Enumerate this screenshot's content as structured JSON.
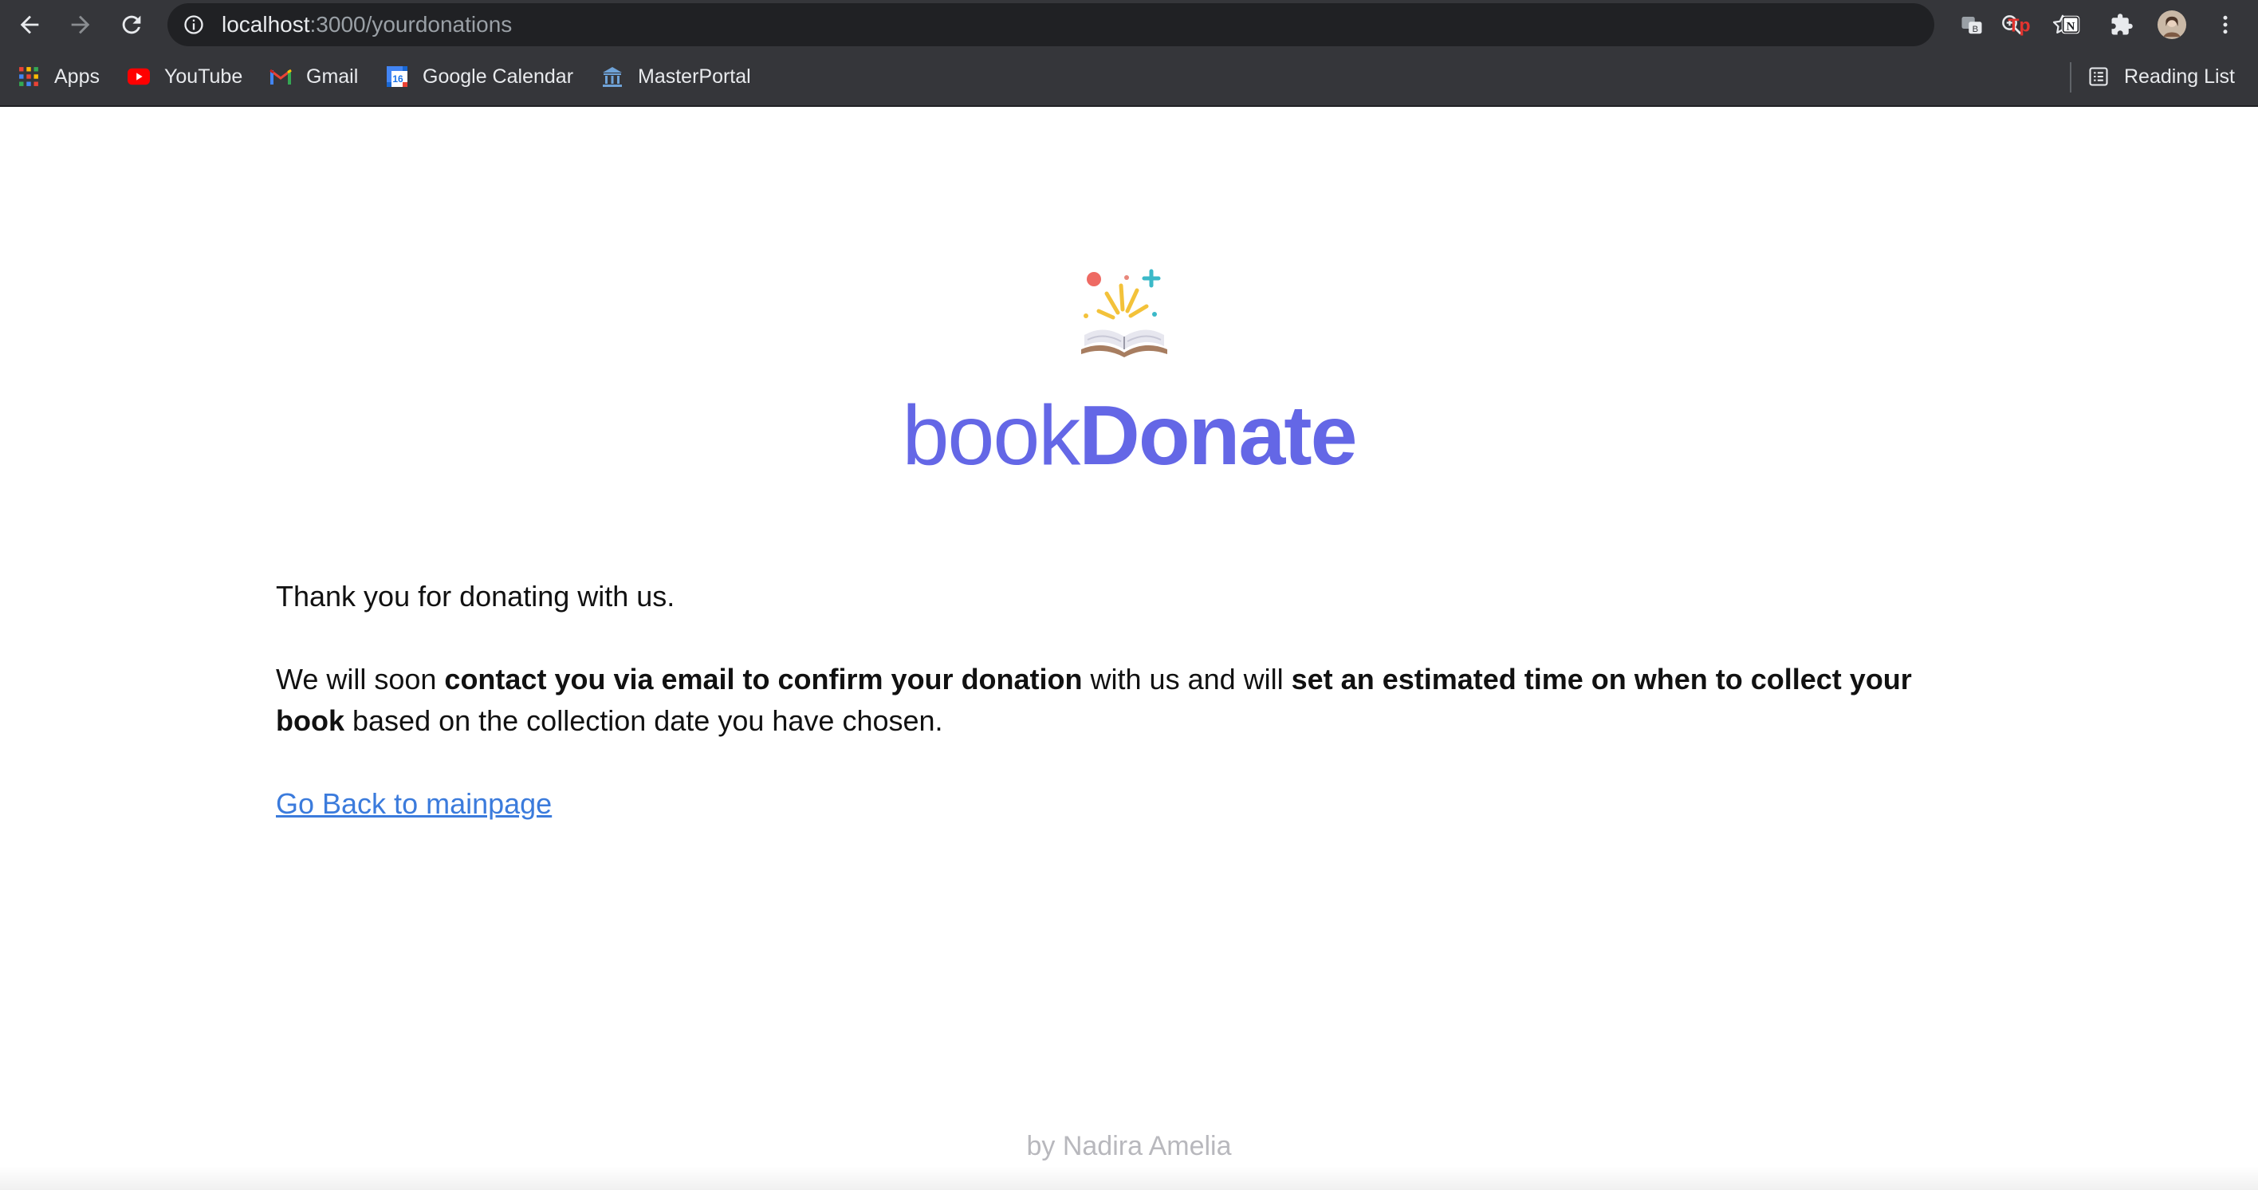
{
  "browser": {
    "url_host": "localhost",
    "url_path": ":3000/yourdonations",
    "bookmarks": [
      {
        "label": "Apps",
        "icon": "apps-grid-icon"
      },
      {
        "label": "YouTube",
        "icon": "youtube-icon"
      },
      {
        "label": "Gmail",
        "icon": "gmail-icon"
      },
      {
        "label": "Google Calendar",
        "icon": "google-calendar-icon"
      },
      {
        "label": "MasterPortal",
        "icon": "masterportal-icon"
      }
    ],
    "reading_list_label": "Reading List",
    "calendar_day": "16"
  },
  "brand": {
    "name_light": "book",
    "name_bold": "Donate",
    "color": "#6467e6"
  },
  "message": {
    "thanks": "Thank you for donating with us.",
    "line_intro": "We will soon ",
    "line_bold_1": "contact you via email to confirm your donation",
    "line_mid": " with us and will ",
    "line_bold_2": "set an estimated time on when to collect your book",
    "line_end": " based on the collection date you have chosen."
  },
  "link": {
    "back_label": "Go Back to mainpage",
    "color": "#3b7bdc"
  },
  "footer": {
    "credit": "by Nadira Amelia"
  }
}
